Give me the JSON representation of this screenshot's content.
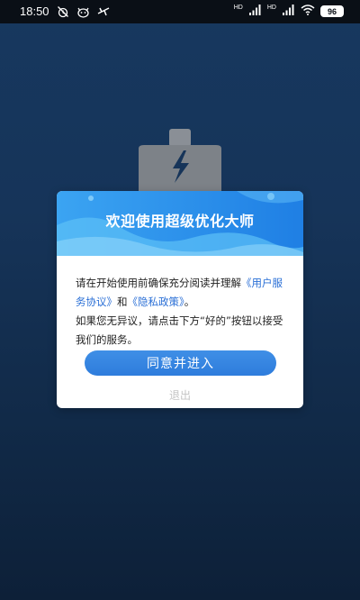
{
  "status_bar": {
    "time": "18:50",
    "signal_1_label": "HD",
    "signal_2_label": "HD",
    "battery": "96",
    "icons": [
      "alarm-off-icon",
      "cat-face-icon",
      "airplane-icon",
      "signal-icon",
      "signal-icon",
      "wifi-icon",
      "battery-icon"
    ]
  },
  "dialog": {
    "title": "欢迎使用超级优化大师",
    "body_prefix": "请在开始使用前确保充分阅读并理解",
    "user_agreement_link": "《用户服务协议》",
    "and_text": "和",
    "privacy_policy_link": "《隐私政策》",
    "period": "。",
    "body_suffix": "如果您无异议，请点击下方“好的”按钮以接受我们的服务。",
    "agree_button": "同意并进入",
    "exit_button": "退出"
  },
  "colors": {
    "background": "#163459",
    "accent": "#2e7cdc",
    "link": "#2a6fd6",
    "header_blue": "#2b8ee8"
  }
}
